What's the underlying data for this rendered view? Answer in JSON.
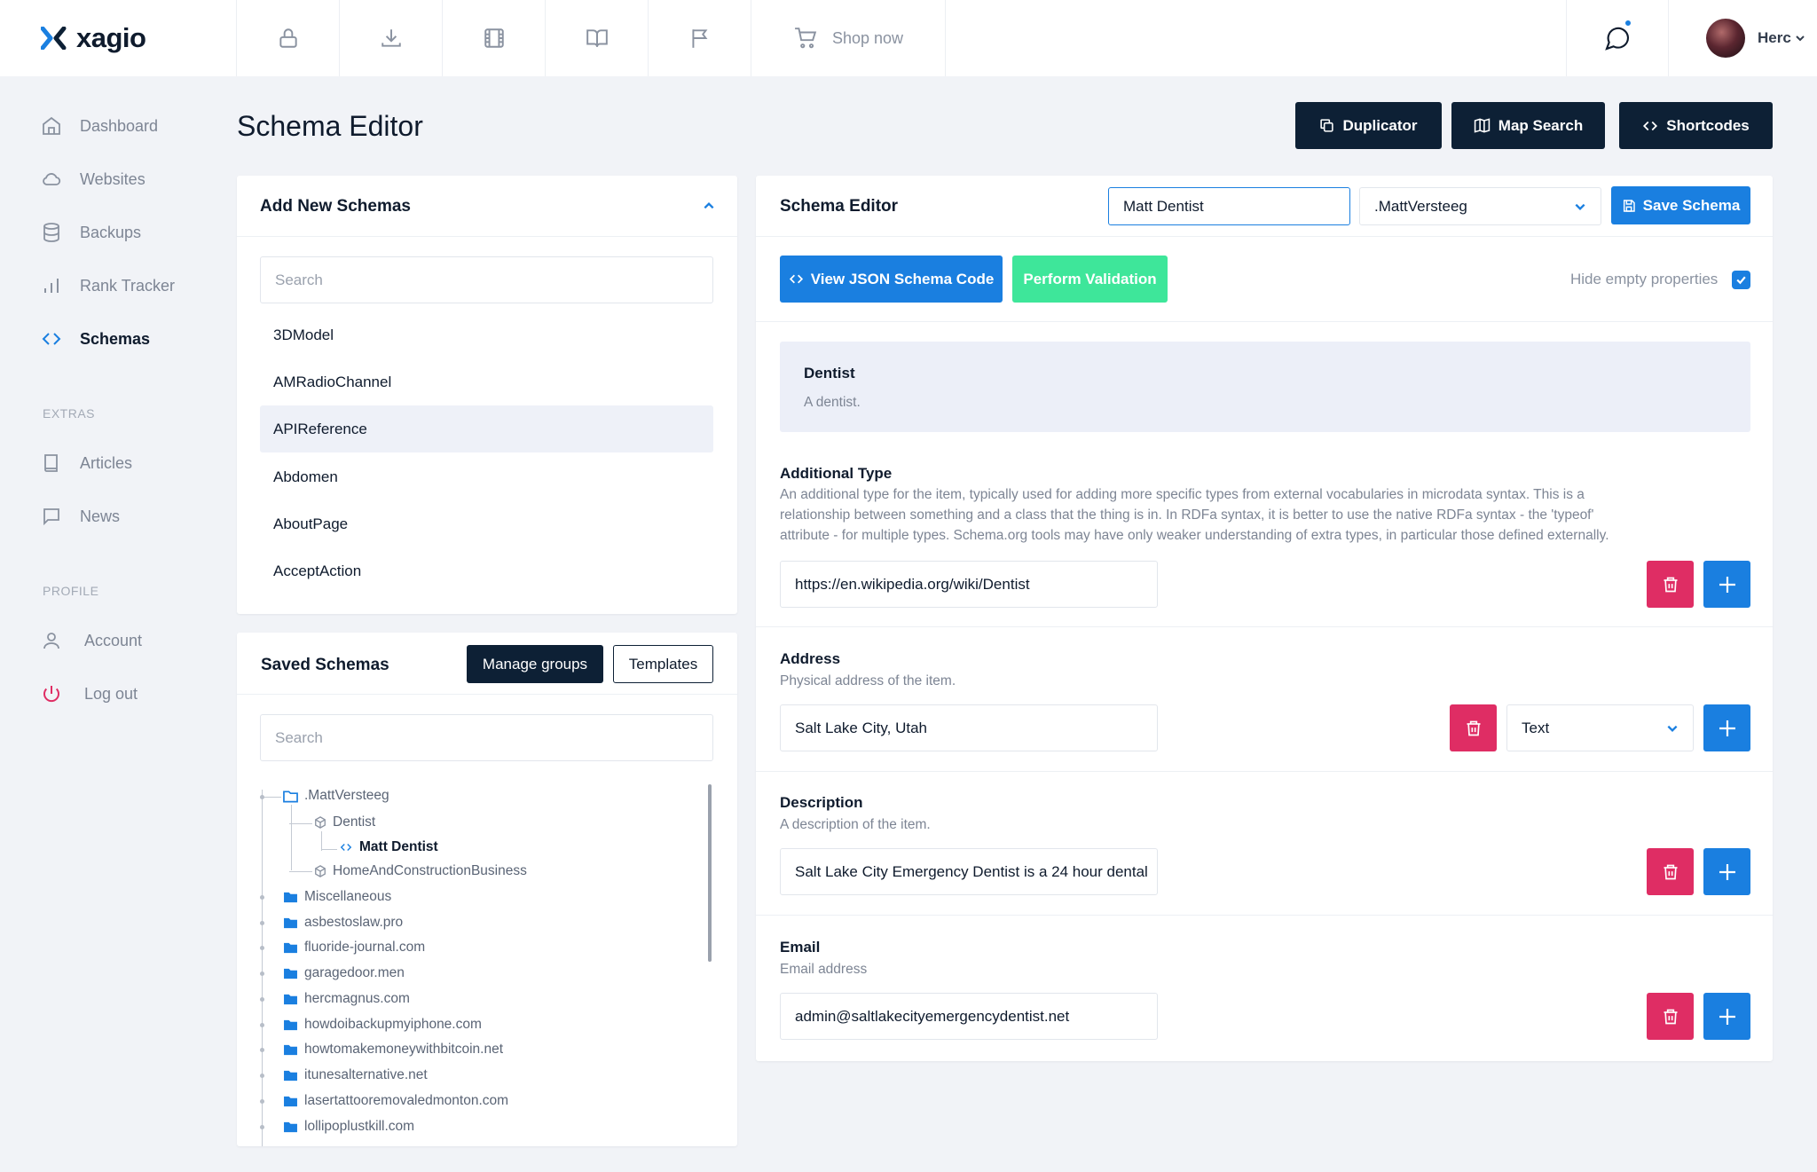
{
  "brand": {
    "name": "xagio",
    "accent": "#1a7fe0",
    "dark": "#0d2035",
    "danger": "#df2d64",
    "success": "#3ee69a"
  },
  "topbar": {
    "tools": [
      "lock-icon",
      "download-icon",
      "film-icon",
      "book-open-icon",
      "flag-icon"
    ],
    "shop_label": "Shop now",
    "user_name": "Herc"
  },
  "sidebar": {
    "items": [
      {
        "label": "Dashboard",
        "icon": "home-icon"
      },
      {
        "label": "Websites",
        "icon": "cloud-icon"
      },
      {
        "label": "Backups",
        "icon": "database-icon"
      },
      {
        "label": "Rank Tracker",
        "icon": "bar-chart-icon"
      },
      {
        "label": "Schemas",
        "icon": "code-icon",
        "active": true
      }
    ],
    "extras_heading": "EXTRAS",
    "extras": [
      {
        "label": "Articles",
        "icon": "book-icon"
      },
      {
        "label": "News",
        "icon": "message-icon"
      }
    ],
    "profile_heading": "PROFILE",
    "profile": [
      {
        "label": "Account",
        "icon": "user-icon"
      },
      {
        "label": "Log out",
        "icon": "power-icon"
      }
    ]
  },
  "page": {
    "title": "Schema Editor",
    "buttons": {
      "duplicator": "Duplicator",
      "map_search": "Map Search",
      "shortcodes": "Shortcodes"
    }
  },
  "add_schemas": {
    "title": "Add New Schemas",
    "search_placeholder": "Search",
    "items": [
      "3DModel",
      "AMRadioChannel",
      "APIReference",
      "Abdomen",
      "AboutPage",
      "AcceptAction"
    ],
    "selected": "APIReference"
  },
  "saved_schemas": {
    "title": "Saved Schemas",
    "manage_groups": "Manage groups",
    "templates": "Templates",
    "search_placeholder": "Search",
    "tree": {
      "root": ".MattVersteeg",
      "dentist": "Dentist",
      "matt_dentist": "Matt Dentist",
      "home_construction": "HomeAndConstructionBusiness",
      "folders": [
        "Miscellaneous",
        "asbestoslaw.pro",
        "fluoride-journal.com",
        "garagedoor.men",
        "hercmagnus.com",
        "howdoibackupmyiphone.com",
        "howtomakemoneywithbitcoin.net",
        "itunesalternative.net",
        "lasertattooremovaledmonton.com",
        "lollipoplustkill.com"
      ]
    }
  },
  "editor": {
    "title": "Schema Editor",
    "schema_name": "Matt Dentist",
    "group_select": ".MattVersteeg",
    "save_label": "Save Schema",
    "view_json_label": "View JSON Schema Code",
    "validate_label": "Perform Validation",
    "hide_empty_label": "Hide empty properties",
    "hide_empty_checked": true,
    "type_title": "Dentist",
    "type_desc": "A dentist.",
    "properties": {
      "additional_type": {
        "title": "Additional Type",
        "desc_lines": [
          "An additional type for the item, typically used for adding more specific types from external vocabularies in microdata syntax. This is a",
          "relationship between something and a class that the thing is in. In RDFa syntax, it is better to use the native RDFa syntax - the 'typeof'",
          "attribute - for multiple types. Schema.org tools may have only weaker understanding of extra types, in particular those defined externally."
        ],
        "value": "https://en.wikipedia.org/wiki/Dentist"
      },
      "address": {
        "title": "Address",
        "desc": "Physical address of the item.",
        "value": "Salt Lake City, Utah",
        "type_select": "Text"
      },
      "description": {
        "title": "Description",
        "desc": "A description of the item.",
        "value": "Salt Lake City Emergency Dentist is a 24 hour dental"
      },
      "email": {
        "title": "Email",
        "desc": "Email address",
        "value": "admin@saltlakecityemergencydentist.net"
      }
    }
  }
}
